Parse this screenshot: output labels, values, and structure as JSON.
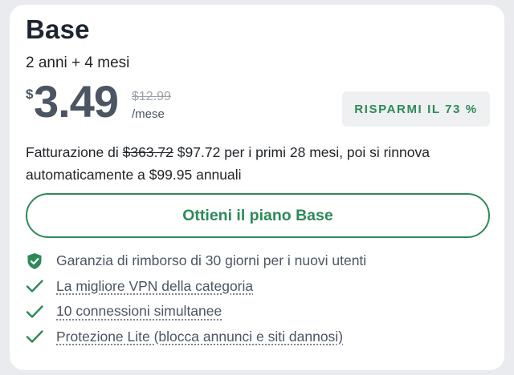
{
  "plan": {
    "name": "Base",
    "duration": "2 anni + 4 mesi"
  },
  "pricing": {
    "currency": "$",
    "price": "3.49",
    "old_price": "$12.99",
    "period": "/mese",
    "savings_badge": "RISPARMI IL 73 %"
  },
  "billing": {
    "prefix": "Fatturazione di",
    "old_total": "$363.72",
    "new_total": "$97.72",
    "suffix": "per i primi 28 mesi, poi si rinnova automaticamente a $99.95 annuali"
  },
  "cta": {
    "label": "Ottieni il piano Base"
  },
  "features": [
    {
      "text": "Garanzia di rimborso di 30 giorni per i nuovi utenti",
      "icon": "shield-check-icon"
    },
    {
      "text": "La migliore VPN della categoria",
      "icon": "checkmark-icon"
    },
    {
      "text": "10 connessioni simultanee",
      "icon": "checkmark-icon"
    },
    {
      "text": "Protezione Lite (blocca annunci e siti dannosi)",
      "icon": "checkmark-icon"
    }
  ],
  "colors": {
    "accent": "#2d8a57",
    "badge_bg": "#eef0f2",
    "price_text": "#4b5563"
  }
}
